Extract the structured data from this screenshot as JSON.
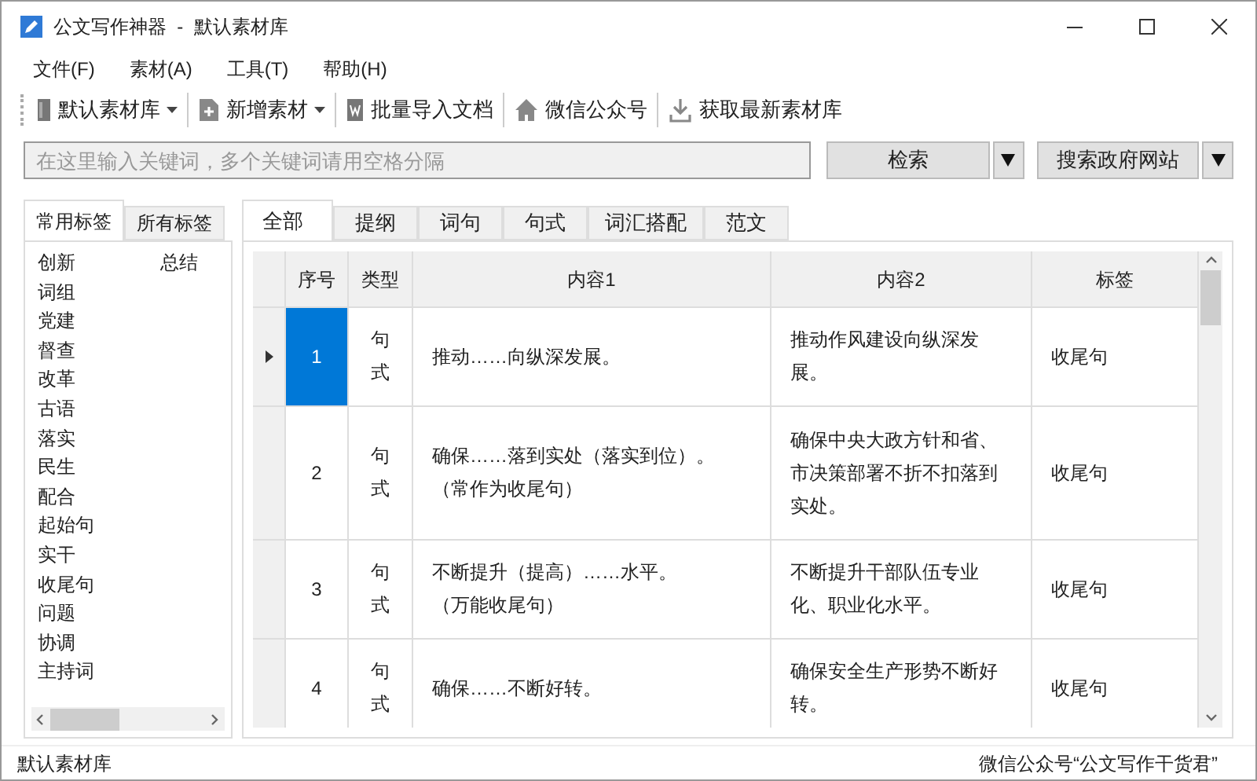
{
  "window": {
    "title": "公文写作神器  -  默认素材库"
  },
  "menu": [
    "文件(F)",
    "素材(A)",
    "工具(T)",
    "帮助(H)"
  ],
  "toolbar": [
    {
      "label": "默认素材库",
      "dropdown": true
    },
    {
      "label": "新增素材",
      "dropdown": true
    },
    {
      "label": "批量导入文档",
      "dropdown": false
    },
    {
      "label": "微信公众号",
      "dropdown": false
    },
    {
      "label": "获取最新素材库",
      "dropdown": false
    }
  ],
  "search": {
    "placeholder": "在这里输入关键词，多个关键词请用空格分隔",
    "search_button": "检索",
    "gov_button": "搜索政府网站"
  },
  "tag_tabs": [
    {
      "label": "常用标签",
      "selected": true
    },
    {
      "label": "所有标签",
      "selected": false
    }
  ],
  "tag_columns": [
    [
      "创新",
      "词组",
      "党建",
      "督查",
      "改革",
      "古语",
      "落实",
      "民生",
      "配合",
      "起始句",
      "实干",
      "收尾句",
      "问题",
      "协调",
      "主持词"
    ],
    [
      "总结"
    ]
  ],
  "content_tabs": [
    {
      "label": "全部",
      "selected": true
    },
    {
      "label": "提纲",
      "selected": false
    },
    {
      "label": "词句",
      "selected": false
    },
    {
      "label": "句式",
      "selected": false
    },
    {
      "label": "词汇搭配",
      "selected": false
    },
    {
      "label": "范文",
      "selected": false
    }
  ],
  "table": {
    "columns": [
      "序号",
      "类型",
      "内容1",
      "内容2",
      "标签"
    ],
    "rows": [
      {
        "selected": true,
        "number": "1",
        "type": "句式",
        "content1": [
          "推动……向纵深发展。"
        ],
        "content2": "推动作风建设向纵深发展。",
        "tag": "收尾句"
      },
      {
        "selected": false,
        "number": "2",
        "type": "句式",
        "content1": [
          "确保……落到实处（落实到位）。",
          "（常作为收尾句）"
        ],
        "content2": "确保中央大政方针和省、市决策部署不折不扣落到实处。",
        "tag": "收尾句"
      },
      {
        "selected": false,
        "number": "3",
        "type": "句式",
        "content1": [
          "不断提升（提高）……水平。",
          "（万能收尾句）"
        ],
        "content2": "不断提升干部队伍专业化、职业化水平。",
        "tag": "收尾句"
      },
      {
        "selected": false,
        "number": "4",
        "type": "句式",
        "content1": [
          "确保……不断好转。"
        ],
        "content2": "确保安全生产形势不断好转。",
        "tag": "收尾句"
      }
    ]
  },
  "status_bar": {
    "left": "默认素材库",
    "right": "微信公众号“公文写作干货君”"
  }
}
